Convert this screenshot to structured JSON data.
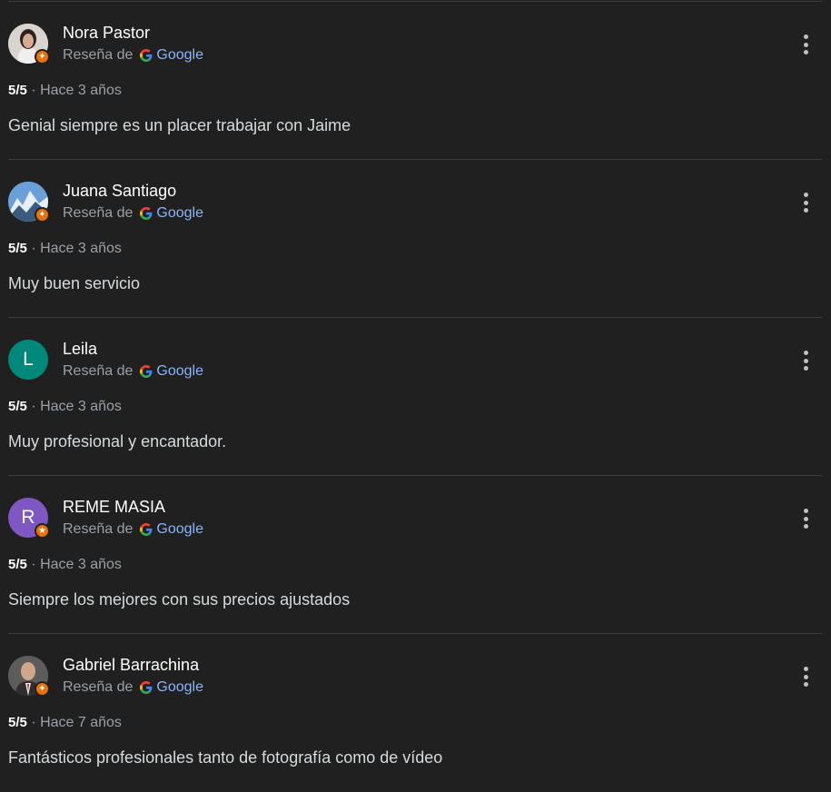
{
  "reviews": [
    {
      "name": "Nora Pastor",
      "source_label": "Reseña de",
      "google_label": "Google",
      "rating": "5/5",
      "separator": "·",
      "time": "Hace 3 años",
      "text": "Genial siempre es un placer trabajar con Jaime",
      "avatar_type": "photo",
      "avatar_color": "#d8d2cc"
    },
    {
      "name": "Juana Santiago",
      "source_label": "Reseña de",
      "google_label": "Google",
      "rating": "5/5",
      "separator": "·",
      "time": "Hace 3 años",
      "text": "Muy buen servicio",
      "avatar_type": "photo",
      "avatar_color": "#5b8fc7"
    },
    {
      "name": "Leila",
      "source_label": "Reseña de",
      "google_label": "Google",
      "rating": "5/5",
      "separator": "·",
      "time": "Hace 3 años",
      "text": "Muy profesional y encantador.",
      "avatar_type": "initial",
      "avatar_initial": "L",
      "avatar_color": "#00897b"
    },
    {
      "name": "REME MASIA",
      "source_label": "Reseña de",
      "google_label": "Google",
      "rating": "5/5",
      "separator": "·",
      "time": "Hace 3 años",
      "text": "Siempre los mejores con sus precios ajustados",
      "avatar_type": "initial",
      "avatar_initial": "R",
      "avatar_color": "#7e57c2"
    },
    {
      "name": "Gabriel Barrachina",
      "source_label": "Reseña de",
      "google_label": "Google",
      "rating": "5/5",
      "separator": "·",
      "time": "Hace 7 años",
      "text": "Fantásticos profesionales tanto de fotografía como de vídeo",
      "avatar_type": "photo",
      "avatar_color": "#6d6d6d"
    }
  ],
  "colors": {
    "background": "#202020",
    "google_link": "#8ab4f8",
    "badge": "#e8710a"
  },
  "icons": {
    "badge": "local-guide-star-icon",
    "source": "google-g-icon",
    "menu": "more-vert-icon"
  }
}
